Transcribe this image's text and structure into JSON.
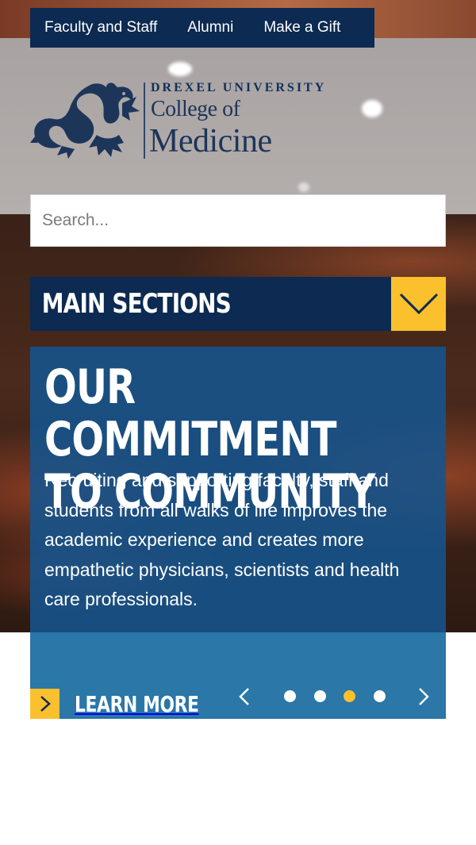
{
  "utility_nav": {
    "items": [
      {
        "label": "Faculty and Staff"
      },
      {
        "label": "Alumni"
      },
      {
        "label": "Make a Gift"
      }
    ]
  },
  "logo": {
    "university": "DREXEL UNIVERSITY",
    "line1": "College of",
    "line2": "Medicine",
    "icon": "dragon-icon"
  },
  "search": {
    "placeholder": "Search..."
  },
  "main_sections": {
    "label": "MAIN SECTIONS",
    "toggle_icon": "chevron-down-icon"
  },
  "feature": {
    "title_line1": "OUR COMMITMENT",
    "title_line2": "TO COMMUNITY",
    "body": "Recruiting and supporting faculty, staff and students from all walks of life improves the academic experience and creates more empathetic physicians, scientists and health care professionals.",
    "cta_label": "LEARN MORE",
    "cta_icon": "chevron-right-icon",
    "pager": {
      "prev_icon": "chevron-left-icon",
      "next_icon": "chevron-right-icon",
      "slide_count": 4,
      "active_index": 2
    }
  },
  "colors": {
    "navy": "#0c2a52",
    "gold": "#fbc02d",
    "feature_blue": "#14548e",
    "feature_lower_blue": "#2a77a8",
    "white": "#ffffff"
  }
}
